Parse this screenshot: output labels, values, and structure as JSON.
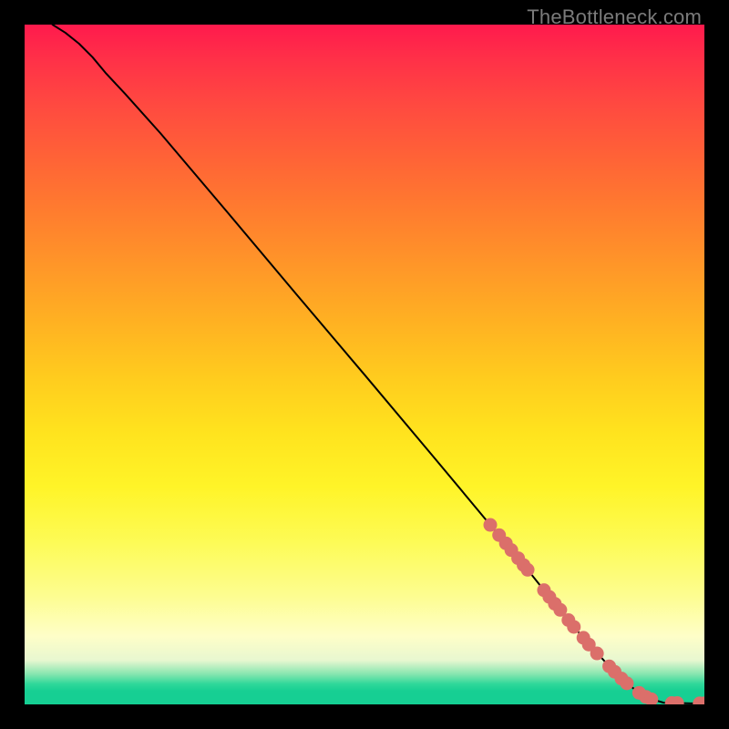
{
  "watermark": "TheBottleneck.com",
  "chart_data": {
    "type": "line",
    "title": "",
    "xlabel": "",
    "ylabel": "",
    "xlim": [
      0,
      100
    ],
    "ylim": [
      0,
      100
    ],
    "series": [
      {
        "name": "curve",
        "x": [
          4.1,
          6.0,
          8.0,
          10.0,
          12.0,
          14.8,
          20.0,
          30.0,
          40.0,
          50.0,
          60.0,
          68.0,
          74.0,
          78.0,
          82.0,
          86.0,
          88.5,
          90.5,
          92.5,
          94.0,
          98.0,
          100.0
        ],
        "y": [
          100.0,
          98.8,
          97.2,
          95.2,
          92.8,
          89.8,
          84.0,
          72.2,
          60.3,
          48.5,
          36.6,
          27.0,
          19.8,
          14.8,
          10.0,
          5.6,
          3.2,
          1.6,
          0.7,
          0.25,
          0.15,
          0.15
        ]
      }
    ],
    "dots": [
      {
        "x": 68.5,
        "y": 26.4
      },
      {
        "x": 69.8,
        "y": 24.9
      },
      {
        "x": 70.8,
        "y": 23.7
      },
      {
        "x": 71.6,
        "y": 22.7
      },
      {
        "x": 72.6,
        "y": 21.5
      },
      {
        "x": 73.4,
        "y": 20.5
      },
      {
        "x": 74.0,
        "y": 19.8
      },
      {
        "x": 76.4,
        "y": 16.8
      },
      {
        "x": 77.2,
        "y": 15.8
      },
      {
        "x": 78.0,
        "y": 14.8
      },
      {
        "x": 78.8,
        "y": 13.9
      },
      {
        "x": 80.0,
        "y": 12.4
      },
      {
        "x": 80.8,
        "y": 11.4
      },
      {
        "x": 82.2,
        "y": 9.8
      },
      {
        "x": 83.0,
        "y": 8.8
      },
      {
        "x": 84.2,
        "y": 7.5
      },
      {
        "x": 86.0,
        "y": 5.6
      },
      {
        "x": 86.8,
        "y": 4.8
      },
      {
        "x": 87.8,
        "y": 3.8
      },
      {
        "x": 88.6,
        "y": 3.1
      },
      {
        "x": 90.4,
        "y": 1.7
      },
      {
        "x": 91.4,
        "y": 1.1
      },
      {
        "x": 92.2,
        "y": 0.75
      },
      {
        "x": 95.2,
        "y": 0.2
      },
      {
        "x": 96.0,
        "y": 0.2
      },
      {
        "x": 99.3,
        "y": 0.15
      },
      {
        "x": 100.0,
        "y": 0.15
      }
    ],
    "colors": {
      "curve": "#000000",
      "dots": "#db6f6a"
    }
  }
}
